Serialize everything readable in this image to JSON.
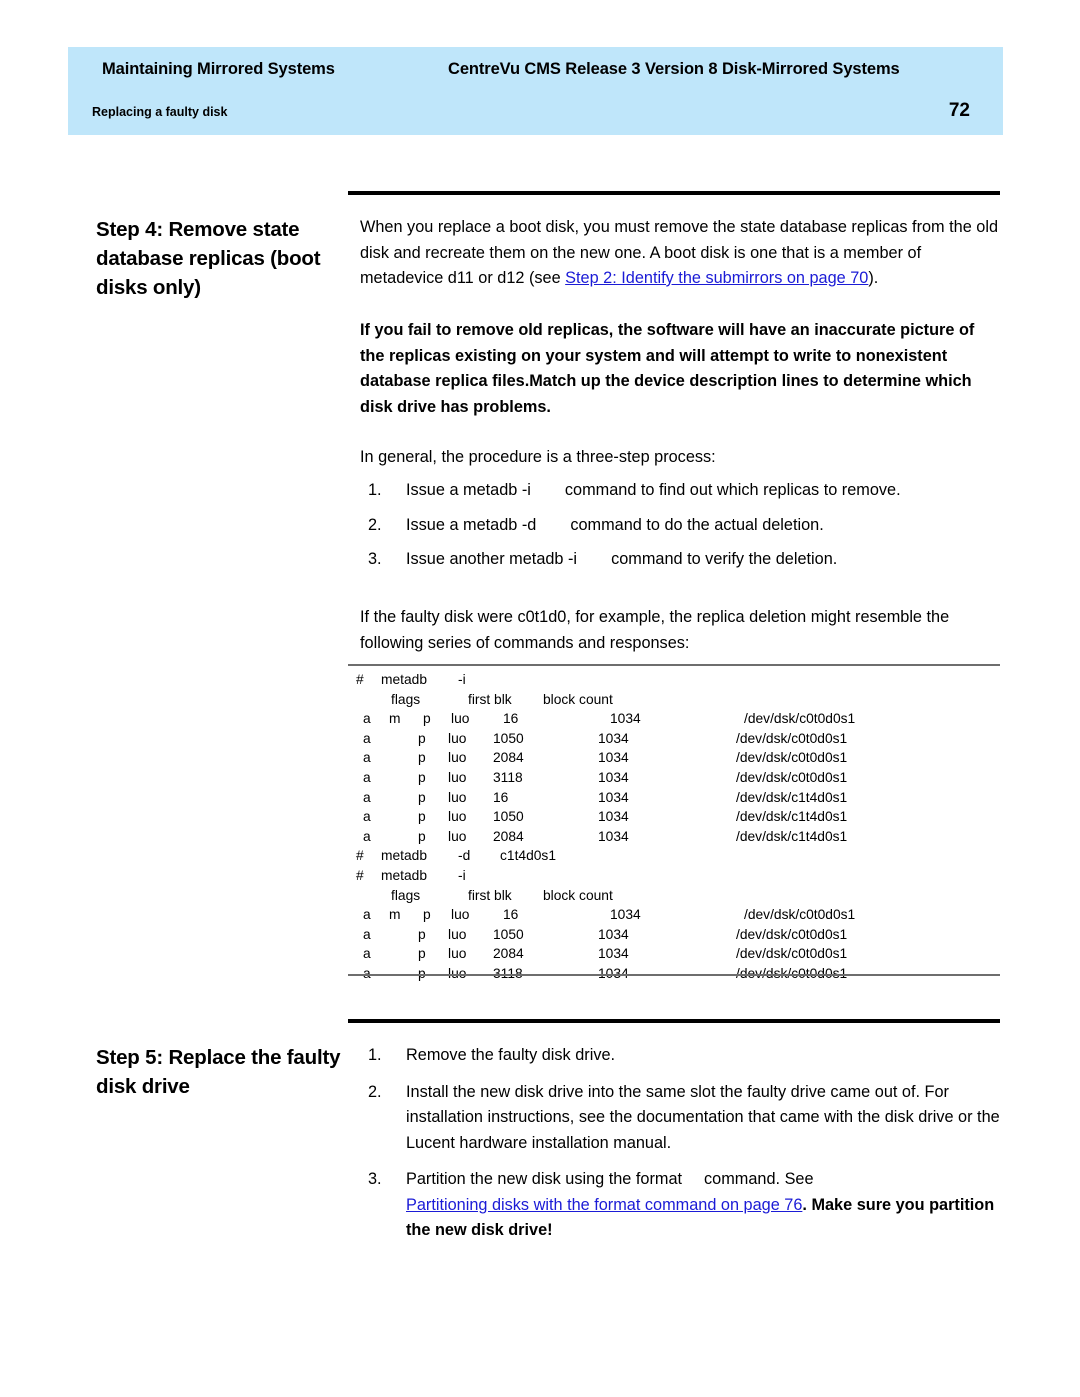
{
  "page": {
    "number": "72",
    "running_header_left": "Maintaining Mirrored Systems",
    "running_header_right": "CentreVu CMS Release 3 Version 8 Disk-Mirrored Systems",
    "running_header_sub": "Replacing a faulty disk",
    "band_color": "#bfe6fa",
    "link_color": "#1b1bd6"
  },
  "step4": {
    "title": "Step 4: Remove state database replicas (boot disks only)",
    "intro_part1": "When you replace a boot disk, you must remove the state database replicas from the old disk and recreate them on the new one. A boot disk is one that is a member of metadevice d11 or d12 (see ",
    "intro_link": " Step 2: Identify the submirrors  on page 70",
    "intro_part2": ").",
    "warning": "If you fail to remove old replicas, the software will have an inaccurate picture of the replicas existing on your system and will attempt to write to nonexistent database replica files.Match up the device description lines to determine which disk drive has problems.",
    "lead_in": "In general, the procedure is a three-step process:",
    "steps": [
      {
        "num": "1.",
        "text_before": "Issue a metadb -i",
        "text_after": "command to find out which replicas to remove."
      },
      {
        "num": "2.",
        "text_before": "Issue a metadb -d",
        "text_after": "command to do the actual deletion."
      },
      {
        "num": "3.",
        "text_before": "Issue another metadb -i",
        "text_after": "command to verify the deletion."
      }
    ],
    "example_intro": "If the faulty disk were c0t1d0, for example, the replica deletion might resemble the following series of commands and responses:",
    "listing": {
      "columns": {
        "flags": "flags",
        "first_blk": "first blk",
        "block_count": "block count"
      },
      "lines": [
        {
          "kind": "cmd",
          "hash": "#",
          "cmd": "metadb",
          "arg": "-i"
        },
        {
          "kind": "header"
        },
        {
          "kind": "row",
          "first": true,
          "a": "a",
          "m": "m",
          "p": "p",
          "luo": "luo",
          "blk": "16",
          "cnt": "1034",
          "dev": "/dev/dsk/c0t0d0s1"
        },
        {
          "kind": "row",
          "a": "a",
          "m": "",
          "p": "p",
          "luo": "luo",
          "blk": "1050",
          "cnt": "1034",
          "dev": "/dev/dsk/c0t0d0s1"
        },
        {
          "kind": "row",
          "a": "a",
          "m": "",
          "p": "p",
          "luo": "luo",
          "blk": "2084",
          "cnt": "1034",
          "dev": "/dev/dsk/c0t0d0s1"
        },
        {
          "kind": "row",
          "a": "a",
          "m": "",
          "p": "p",
          "luo": "luo",
          "blk": "3118",
          "cnt": "1034",
          "dev": "/dev/dsk/c0t0d0s1"
        },
        {
          "kind": "row",
          "a": "a",
          "m": "",
          "p": "p",
          "luo": "luo",
          "blk": "16",
          "cnt": "1034",
          "dev": "/dev/dsk/c1t4d0s1"
        },
        {
          "kind": "row",
          "a": "a",
          "m": "",
          "p": "p",
          "luo": "luo",
          "blk": "1050",
          "cnt": "1034",
          "dev": "/dev/dsk/c1t4d0s1"
        },
        {
          "kind": "row",
          "a": "a",
          "m": "",
          "p": "p",
          "luo": "luo",
          "blk": "2084",
          "cnt": "1034",
          "dev": "/dev/dsk/c1t4d0s1"
        },
        {
          "kind": "cmd",
          "hash": "#",
          "cmd": "metadb",
          "arg": "-d",
          "arg2": "c1t4d0s1"
        },
        {
          "kind": "cmd",
          "hash": "#",
          "cmd": "metadb",
          "arg": "-i"
        },
        {
          "kind": "header"
        },
        {
          "kind": "row",
          "first": true,
          "a": "a",
          "m": "m",
          "p": "p",
          "luo": "luo",
          "blk": "16",
          "cnt": "1034",
          "dev": "/dev/dsk/c0t0d0s1"
        },
        {
          "kind": "row",
          "a": "a",
          "m": "",
          "p": "p",
          "luo": "luo",
          "blk": "1050",
          "cnt": "1034",
          "dev": "/dev/dsk/c0t0d0s1"
        },
        {
          "kind": "row",
          "a": "a",
          "m": "",
          "p": "p",
          "luo": "luo",
          "blk": "2084",
          "cnt": "1034",
          "dev": "/dev/dsk/c0t0d0s1"
        },
        {
          "kind": "row",
          "a": "a",
          "m": "",
          "p": "p",
          "luo": "luo",
          "blk": "3118",
          "cnt": "1034",
          "dev": "/dev/dsk/c0t0d0s1"
        }
      ]
    }
  },
  "step5": {
    "title": "Step 5: Replace the faulty disk drive",
    "steps": [
      {
        "num": "1.",
        "text": "Remove the faulty disk drive."
      },
      {
        "num": "2.",
        "text": "Install the new disk drive into the same slot the faulty drive came out of. For installation instructions, see the documentation that came with the disk drive or the Lucent hardware installation manual."
      }
    ],
    "step3": {
      "num": "3.",
      "text_before": "Partition the new disk using the format",
      "text_mid": "command. See",
      "link": " Partitioning disks with the format command  on page 76",
      "text_after": ". Make sure you partition the new disk drive!"
    }
  }
}
